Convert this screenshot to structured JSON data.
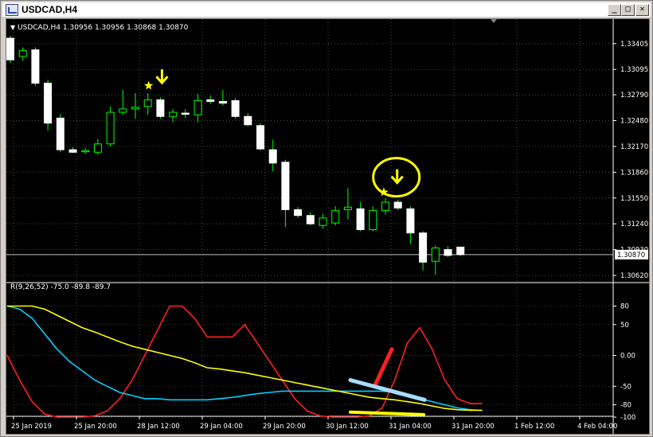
{
  "window": {
    "title": "USDCAD,H4",
    "controls": {
      "minimize": "_",
      "restore": "□",
      "close": "✕"
    }
  },
  "price_panel": {
    "header": {
      "symbol": "USDCAD,H4",
      "o": "1.30956",
      "h": "1.30956",
      "l": "1.30868",
      "c": "1.30870"
    },
    "price_ticks": [
      "1.33405",
      "1.33095",
      "1.32790",
      "1.32480",
      "1.32170",
      "1.31860",
      "1.31550",
      "1.31240",
      "1.30930",
      "1.30620"
    ],
    "current_price": "1.30870"
  },
  "indicator_panel": {
    "label": "R(9,26,52) -75.0 -89.8 -89.7",
    "ticks": [
      "80",
      "50",
      "0.00",
      "-50",
      "-80",
      "-100"
    ]
  },
  "time_axis": {
    "labels": [
      "25 Jan 2019",
      "25 Jan 20:00",
      "28 Jan 12:00",
      "29 Jan 04:00",
      "29 Jan 20:00",
      "30 Jan 12:00",
      "31 Jan 04:00",
      "31 Jan 20:00",
      "1 Feb 12:00",
      "4 Feb 04:00"
    ]
  },
  "chart_data": [
    {
      "type": "candlestick",
      "symbol": "USDCAD",
      "timeframe": "H4",
      "ylim": [
        1.3062,
        1.3347
      ],
      "candles": [
        {
          "o": 1.3347,
          "h": 1.335,
          "c": 1.3321,
          "l": 1.3317
        },
        {
          "o": 1.3325,
          "h": 1.3336,
          "c": 1.3332,
          "l": 1.332
        },
        {
          "o": 1.3333,
          "h": 1.3336,
          "c": 1.3293,
          "l": 1.329
        },
        {
          "o": 1.3293,
          "h": 1.3297,
          "c": 1.3245,
          "l": 1.3236
        },
        {
          "o": 1.3251,
          "h": 1.3256,
          "c": 1.3213,
          "l": 1.321
        },
        {
          "o": 1.3213,
          "h": 1.3216,
          "c": 1.321,
          "l": 1.3209
        },
        {
          "o": 1.3211,
          "h": 1.3215,
          "c": 1.3212,
          "l": 1.3208
        },
        {
          "o": 1.321,
          "h": 1.3226,
          "c": 1.322,
          "l": 1.3207
        },
        {
          "o": 1.322,
          "h": 1.3265,
          "c": 1.3258,
          "l": 1.3217
        },
        {
          "o": 1.3258,
          "h": 1.3285,
          "c": 1.3262,
          "l": 1.3255
        },
        {
          "o": 1.3262,
          "h": 1.3281,
          "c": 1.3264,
          "l": 1.325
        },
        {
          "o": 1.3265,
          "h": 1.3281,
          "c": 1.3273,
          "l": 1.3255
        },
        {
          "o": 1.3273,
          "h": 1.3276,
          "c": 1.3253,
          "l": 1.325
        },
        {
          "o": 1.3253,
          "h": 1.3262,
          "c": 1.3258,
          "l": 1.3246
        },
        {
          "o": 1.3257,
          "h": 1.3262,
          "c": 1.3256,
          "l": 1.3251
        },
        {
          "o": 1.3255,
          "h": 1.328,
          "c": 1.3272,
          "l": 1.3246
        },
        {
          "o": 1.3273,
          "h": 1.3278,
          "c": 1.3271,
          "l": 1.3268
        },
        {
          "o": 1.3271,
          "h": 1.3285,
          "c": 1.3269,
          "l": 1.3266
        },
        {
          "o": 1.3272,
          "h": 1.3275,
          "c": 1.3253,
          "l": 1.325
        },
        {
          "o": 1.3253,
          "h": 1.3257,
          "c": 1.3243,
          "l": 1.3241
        },
        {
          "o": 1.3242,
          "h": 1.3245,
          "c": 1.3214,
          "l": 1.3212
        },
        {
          "o": 1.3213,
          "h": 1.3225,
          "c": 1.3197,
          "l": 1.3187
        },
        {
          "o": 1.3198,
          "h": 1.3201,
          "c": 1.3141,
          "l": 1.312
        },
        {
          "o": 1.3141,
          "h": 1.3144,
          "c": 1.3134,
          "l": 1.3131
        },
        {
          "o": 1.3134,
          "h": 1.3138,
          "c": 1.3124,
          "l": 1.3122
        },
        {
          "o": 1.3122,
          "h": 1.3136,
          "c": 1.3131,
          "l": 1.3118
        },
        {
          "o": 1.3125,
          "h": 1.3145,
          "c": 1.314,
          "l": 1.3122
        },
        {
          "o": 1.3141,
          "h": 1.3167,
          "c": 1.3144,
          "l": 1.3129
        },
        {
          "o": 1.3142,
          "h": 1.315,
          "c": 1.3117,
          "l": 1.3115
        },
        {
          "o": 1.3117,
          "h": 1.3145,
          "c": 1.314,
          "l": 1.3115
        },
        {
          "o": 1.314,
          "h": 1.3155,
          "c": 1.315,
          "l": 1.3135
        },
        {
          "o": 1.315,
          "h": 1.3153,
          "c": 1.3143,
          "l": 1.314
        },
        {
          "o": 1.3142,
          "h": 1.3145,
          "c": 1.3113,
          "l": 1.31
        },
        {
          "o": 1.3113,
          "h": 1.3115,
          "c": 1.3078,
          "l": 1.3068
        },
        {
          "o": 1.3079,
          "h": 1.3098,
          "c": 1.3095,
          "l": 1.3063
        },
        {
          "o": 1.3093,
          "h": 1.3097,
          "c": 1.3086,
          "l": 1.3084
        },
        {
          "o": 1.3096,
          "h": 1.3096,
          "c": 1.3087,
          "l": 1.3085
        }
      ],
      "annotations": [
        "star",
        "down-arrow",
        "star",
        "down-arrow",
        "circle"
      ]
    },
    {
      "type": "line",
      "title": "R(9,26,52)",
      "ylim": [
        -100,
        100
      ],
      "series": [
        {
          "color": "#ff2020",
          "values": [
            0,
            -40,
            -75,
            -95,
            -100,
            -100,
            -100,
            -98,
            -90,
            -70,
            -40,
            0,
            40,
            80,
            80,
            60,
            30,
            30,
            30,
            50,
            20,
            -10,
            -40,
            -70,
            -90,
            -98,
            -100,
            -100,
            -100,
            -98,
            -85,
            -40,
            20,
            45,
            10,
            -40,
            -70,
            -78,
            -78
          ]
        },
        {
          "color": "#00d0ff",
          "values": [
            80,
            75,
            60,
            35,
            10,
            -10,
            -25,
            -40,
            -50,
            -60,
            -65,
            -70,
            -70,
            -72,
            -72,
            -72,
            -72,
            -70,
            -68,
            -65,
            -62,
            -60,
            -58,
            -58,
            -58,
            -58,
            -58,
            -58,
            -58,
            -58,
            -58,
            -60,
            -65,
            -70,
            -75,
            -80,
            -85,
            -88,
            -89
          ]
        },
        {
          "color": "#ffff00",
          "values": [
            80,
            80,
            80,
            75,
            65,
            55,
            45,
            38,
            30,
            22,
            15,
            10,
            5,
            0,
            -5,
            -12,
            -20,
            -22,
            -25,
            -28,
            -32,
            -36,
            -40,
            -44,
            -48,
            -52,
            -56,
            -60,
            -64,
            -68,
            -70,
            -72,
            -75,
            -78,
            -82,
            -86,
            -88,
            -89,
            -89
          ]
        }
      ],
      "drawn_lines": [
        {
          "color": "#ff2020"
        },
        {
          "color": "#a8dcff"
        },
        {
          "color": "#ffff00"
        }
      ]
    }
  ]
}
